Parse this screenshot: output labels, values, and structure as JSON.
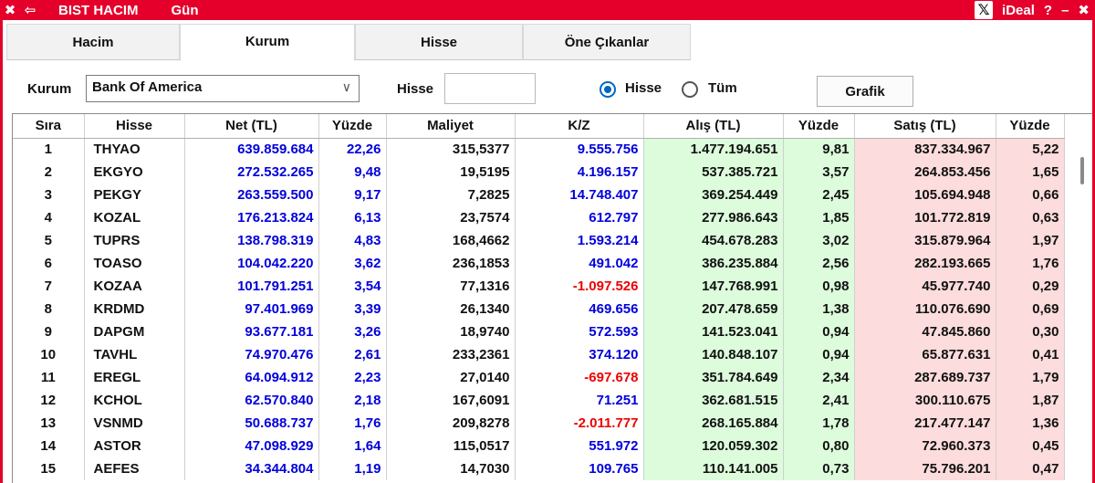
{
  "titlebar": {
    "close_glyph": "✖",
    "back_glyph": "⇦",
    "title": "BIST HACIM",
    "period": "Gün",
    "brand": "iDeal",
    "help": "?",
    "minimize": "–",
    "close": "✖"
  },
  "tabs": [
    {
      "label": "Hacim",
      "active": false
    },
    {
      "label": "Kurum",
      "active": true
    },
    {
      "label": "Hisse",
      "active": false
    },
    {
      "label": "Öne Çıkanlar",
      "active": false
    }
  ],
  "filters": {
    "kurum_label": "Kurum",
    "kurum_value": "Bank Of America",
    "hisse_label": "Hisse",
    "hisse_value": "",
    "radio_hisse": "Hisse",
    "radio_tum": "Tüm",
    "selected_radio": "Hisse",
    "grafik_button": "Grafik"
  },
  "table": {
    "columns": [
      "Sıra",
      "Hisse",
      "Net (TL)",
      "Yüzde",
      "Maliyet",
      "K/Z",
      "Alış (TL)",
      "Yüzde",
      "Satış (TL)",
      "Yüzde"
    ],
    "rows": [
      [
        "1",
        "THYAO",
        "639.859.684",
        "22,26",
        "315,5377",
        "9.555.756",
        "1.477.194.651",
        "9,81",
        "837.334.967",
        "5,22"
      ],
      [
        "2",
        "EKGYO",
        "272.532.265",
        "9,48",
        "19,5195",
        "4.196.157",
        "537.385.721",
        "3,57",
        "264.853.456",
        "1,65"
      ],
      [
        "3",
        "PEKGY",
        "263.559.500",
        "9,17",
        "7,2825",
        "14.748.407",
        "369.254.449",
        "2,45",
        "105.694.948",
        "0,66"
      ],
      [
        "4",
        "KOZAL",
        "176.213.824",
        "6,13",
        "23,7574",
        "612.797",
        "277.986.643",
        "1,85",
        "101.772.819",
        "0,63"
      ],
      [
        "5",
        "TUPRS",
        "138.798.319",
        "4,83",
        "168,4662",
        "1.593.214",
        "454.678.283",
        "3,02",
        "315.879.964",
        "1,97"
      ],
      [
        "6",
        "TOASO",
        "104.042.220",
        "3,62",
        "236,1853",
        "491.042",
        "386.235.884",
        "2,56",
        "282.193.665",
        "1,76"
      ],
      [
        "7",
        "KOZAA",
        "101.791.251",
        "3,54",
        "77,1316",
        "-1.097.526",
        "147.768.991",
        "0,98",
        "45.977.740",
        "0,29"
      ],
      [
        "8",
        "KRDMD",
        "97.401.969",
        "3,39",
        "26,1340",
        "469.656",
        "207.478.659",
        "1,38",
        "110.076.690",
        "0,69"
      ],
      [
        "9",
        "DAPGM",
        "93.677.181",
        "3,26",
        "18,9740",
        "572.593",
        "141.523.041",
        "0,94",
        "47.845.860",
        "0,30"
      ],
      [
        "10",
        "TAVHL",
        "74.970.476",
        "2,61",
        "233,2361",
        "374.120",
        "140.848.107",
        "0,94",
        "65.877.631",
        "0,41"
      ],
      [
        "11",
        "EREGL",
        "64.094.912",
        "2,23",
        "27,0140",
        "-697.678",
        "351.784.649",
        "2,34",
        "287.689.737",
        "1,79"
      ],
      [
        "12",
        "KCHOL",
        "62.570.840",
        "2,18",
        "167,6091",
        "71.251",
        "362.681.515",
        "2,41",
        "300.110.675",
        "1,87"
      ],
      [
        "13",
        "VSNMD",
        "50.688.737",
        "1,76",
        "209,8278",
        "-2.011.777",
        "268.165.884",
        "1,78",
        "217.477.147",
        "1,36"
      ],
      [
        "14",
        "ASTOR",
        "47.098.929",
        "1,64",
        "115,0517",
        "551.972",
        "120.059.302",
        "0,80",
        "72.960.373",
        "0,45"
      ],
      [
        "15",
        "AEFES",
        "34.344.804",
        "1,19",
        "14,7030",
        "109.765",
        "110.141.005",
        "0,73",
        "75.796.201",
        "0,47"
      ]
    ]
  },
  "colors": {
    "accent": "#e4002b",
    "positive_text": "#0000dd",
    "negative_text": "#ee0000",
    "buy_bg": "#dcfcdc",
    "sell_bg": "#fcdcdc"
  }
}
